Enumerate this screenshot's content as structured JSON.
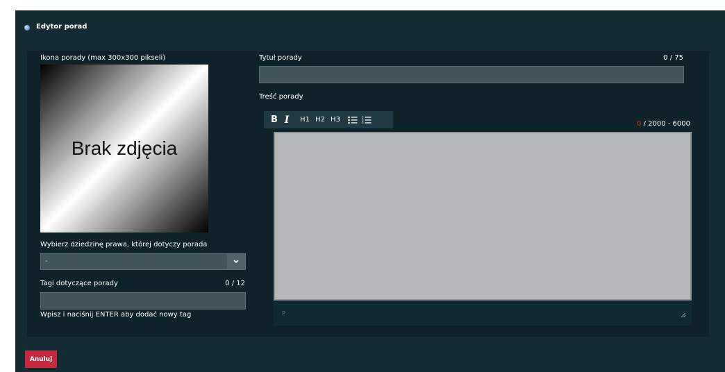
{
  "header": {
    "title": "Edytor porad",
    "icon": "globe-icon"
  },
  "left": {
    "icon_label": "Ikona porady (max 300x300 pikseli)",
    "image_placeholder": "Brak zdjęcia",
    "domain_label": "Wybierz dziedzinę prawa, której dotyczy porada",
    "domain_selected": "-",
    "tags_label": "Tagi dotyczące porady",
    "tags_counter": "0 / 12",
    "tags_value": "",
    "tags_hint": "Wpisz i naciśnij ENTER aby dodać nowy tag"
  },
  "right": {
    "title_label": "Tytuł porady",
    "title_counter": "0 / 75",
    "title_value": "",
    "content_label": "Treść porady",
    "content_counter_current": "0",
    "content_counter_range": " / 2000 - 6000",
    "status_element": "P",
    "toolbar": {
      "bold": "B",
      "italic": "I",
      "h1": "H1",
      "h2": "H2",
      "h3": "H3"
    }
  },
  "actions": {
    "cancel": "Anuluj"
  },
  "colors": {
    "panel_bg": "#132b33",
    "inner_bg": "#0e2329",
    "cancel_bg": "#c6283f",
    "editor_bg": "#b4b8b9",
    "counter_red": "#d42a2a"
  }
}
